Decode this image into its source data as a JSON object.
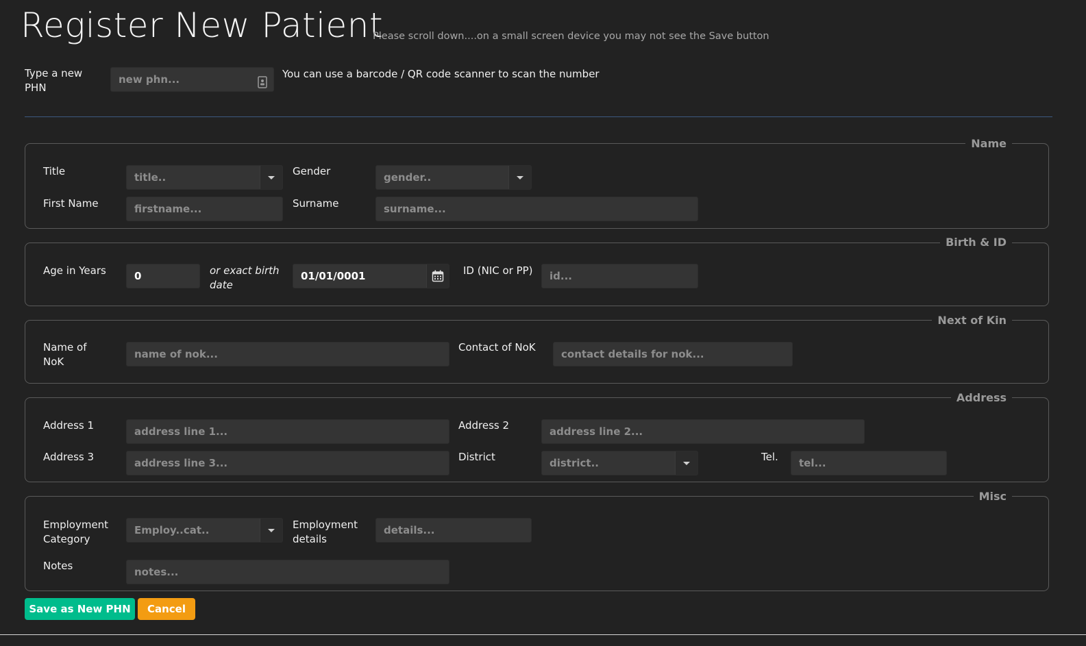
{
  "page": {
    "title": "Register New Patient",
    "subtitle": "Please scroll down....on a small screen device you may not see the Save button"
  },
  "phn": {
    "label": "Type a new PHN",
    "placeholder": "new phn...",
    "hint": "You can use a barcode / QR code scanner to scan the number",
    "icon": "contact-card-icon"
  },
  "sections": {
    "name": {
      "legend": "Name",
      "title_label": "Title",
      "title_placeholder": "title..",
      "gender_label": "Gender",
      "gender_placeholder": "gender..",
      "firstname_label": "First Name",
      "firstname_placeholder": "firstname...",
      "surname_label": "Surname",
      "surname_placeholder": "surname..."
    },
    "birth": {
      "legend": "Birth & ID",
      "age_label": "Age in Years",
      "age_value": "0",
      "exact_label": "or exact birth date",
      "date_value": "01/01/0001",
      "id_label": "ID (NIC or PP)",
      "id_placeholder": "id..."
    },
    "nok": {
      "legend": "Next of Kin",
      "name_label": "Name of NoK",
      "name_placeholder": "name of nok...",
      "contact_label": "Contact of NoK",
      "contact_placeholder": "contact details for nok..."
    },
    "address": {
      "legend": "Address",
      "a1_label": "Address 1",
      "a1_placeholder": "address line 1...",
      "a2_label": "Address 2",
      "a2_placeholder": "address line 2...",
      "a3_label": "Address 3",
      "a3_placeholder": "address line 3...",
      "district_label": "District",
      "district_placeholder": "district..",
      "tel_label": "Tel.",
      "tel_placeholder": "tel..."
    },
    "misc": {
      "legend": "Misc",
      "empcat_label": "Employment Category",
      "empcat_placeholder": "Employ..cat..",
      "empdet_label": "Employment details",
      "empdet_placeholder": "details...",
      "notes_label": "Notes",
      "notes_placeholder": "notes..."
    }
  },
  "buttons": {
    "save": "Save as New PHN",
    "cancel": "Cancel"
  },
  "colors": {
    "background": "#222222",
    "save": "#00bc8c",
    "cancel": "#f39c12",
    "divider": "#3c5a80"
  }
}
